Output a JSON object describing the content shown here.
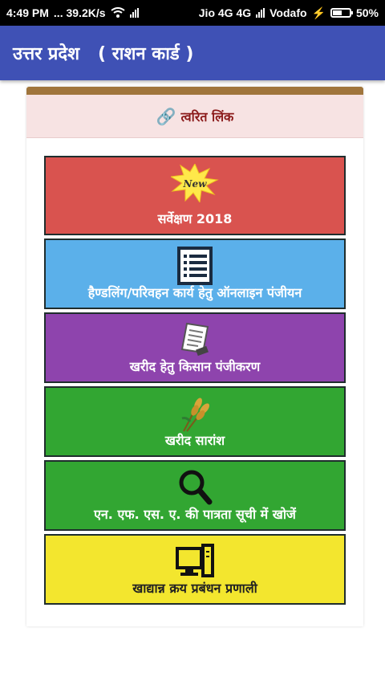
{
  "status_bar": {
    "time": "4:49 PM",
    "speed": "... 39.2K/s",
    "carrier1": "Jio 4G 4G",
    "carrier2": "Vodafo",
    "battery": "50%"
  },
  "app_bar": {
    "title": "उत्तर प्रदेश   ( राशन कार्ड )"
  },
  "panel": {
    "header_label": "त्वरित लिंक",
    "tiles": [
      {
        "label": "सर्वेक्षण 2018",
        "badge": "New",
        "icon": "new-badge-icon",
        "color": "#d9534f"
      },
      {
        "label": "हैण्डलिंग/परिवहन कार्य हेतु ऑनलाइन पंजीयन",
        "icon": "list-icon",
        "color": "#5bb0ea"
      },
      {
        "label": "खरीद हेतु किसान पंजीकरण",
        "icon": "document-icon",
        "color": "#8e44ad"
      },
      {
        "label": "खरीद सारांश",
        "icon": "wheat-icon",
        "color": "#32a632"
      },
      {
        "label": "एन. एफ. एस. ए. की पात्रता सूची में खोजें",
        "icon": "search-icon",
        "color": "#32a632"
      },
      {
        "label": "खाद्यान्न क्रय प्रबंधन प्रणाली",
        "icon": "computer-icon",
        "color": "#f3e62e"
      }
    ]
  }
}
